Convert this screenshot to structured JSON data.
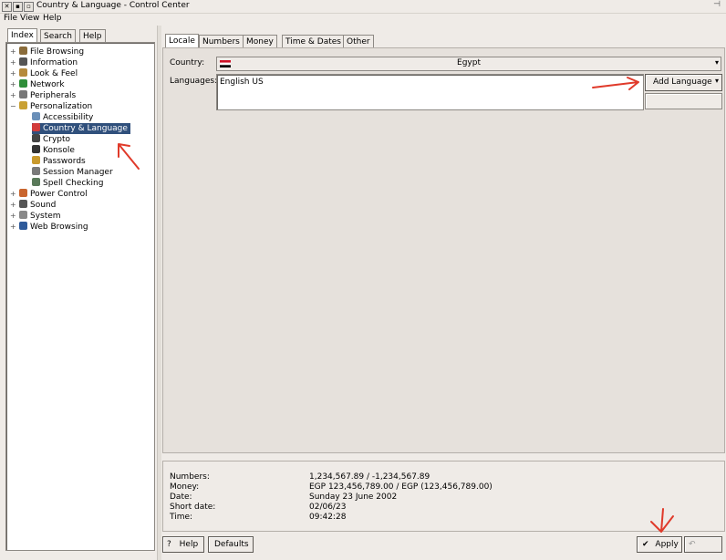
{
  "window": {
    "title": "Country & Language - Control Center"
  },
  "menubar": [
    "File",
    "View",
    "Help"
  ],
  "left_tabs": [
    "Index",
    "Search",
    "Help"
  ],
  "tree": [
    {
      "label": "File Browsing",
      "icon": "folder-icon",
      "color": "#8a6c3a"
    },
    {
      "label": "Information",
      "icon": "info-icon",
      "color": "#555555"
    },
    {
      "label": "Look & Feel",
      "icon": "brush-icon",
      "color": "#b58a3c"
    },
    {
      "label": "Network",
      "icon": "globe-icon",
      "color": "#2f8f3a"
    },
    {
      "label": "Peripherals",
      "icon": "mouse-icon",
      "color": "#777777"
    },
    {
      "label": "Personalization",
      "icon": "personalization-icon",
      "color": "#c9a133"
    },
    {
      "label": "Accessibility",
      "icon": "accessibility-icon",
      "color": "#6a8fb8"
    },
    {
      "label": "Country & Language",
      "icon": "flag-icon",
      "color": "#d23b3b"
    },
    {
      "label": "Crypto",
      "icon": "lock-icon",
      "color": "#444444"
    },
    {
      "label": "Konsole",
      "icon": "terminal-icon",
      "color": "#333333"
    },
    {
      "label": "Passwords",
      "icon": "key-icon",
      "color": "#c99a2e"
    },
    {
      "label": "Session Manager",
      "icon": "session-icon",
      "color": "#7a7a7a"
    },
    {
      "label": "Spell Checking",
      "icon": "spellcheck-icon",
      "color": "#5a7a5a"
    },
    {
      "label": "Power Control",
      "icon": "power-icon",
      "color": "#c9652e"
    },
    {
      "label": "Sound",
      "icon": "speaker-icon",
      "color": "#555555"
    },
    {
      "label": "System",
      "icon": "gear-icon",
      "color": "#888888"
    },
    {
      "label": "Web Browsing",
      "icon": "web-icon",
      "color": "#2e5a9a"
    }
  ],
  "right_tabs": [
    "Locale",
    "Numbers",
    "Money",
    "Time & Dates",
    "Other"
  ],
  "locale": {
    "country_label": "Country:",
    "country_value": "Egypt",
    "languages_label": "Languages:",
    "languages": [
      "English US"
    ],
    "add_language": "Add Language"
  },
  "preview": {
    "rows": [
      {
        "label": "Numbers:",
        "value": "1,234,567.89 / -1,234,567.89"
      },
      {
        "label": "Money:",
        "value": "EGP 123,456,789.00 / EGP (123,456,789.00)"
      },
      {
        "label": "Date:",
        "value": "Sunday 23 June 2002"
      },
      {
        "label": "Short date:",
        "value": "02/06/23"
      },
      {
        "label": "Time:",
        "value": "09:42:28"
      }
    ]
  },
  "buttons": {
    "help": "Help",
    "defaults": "Defaults",
    "apply": "Apply"
  },
  "annotation_color": "#e03a2a"
}
